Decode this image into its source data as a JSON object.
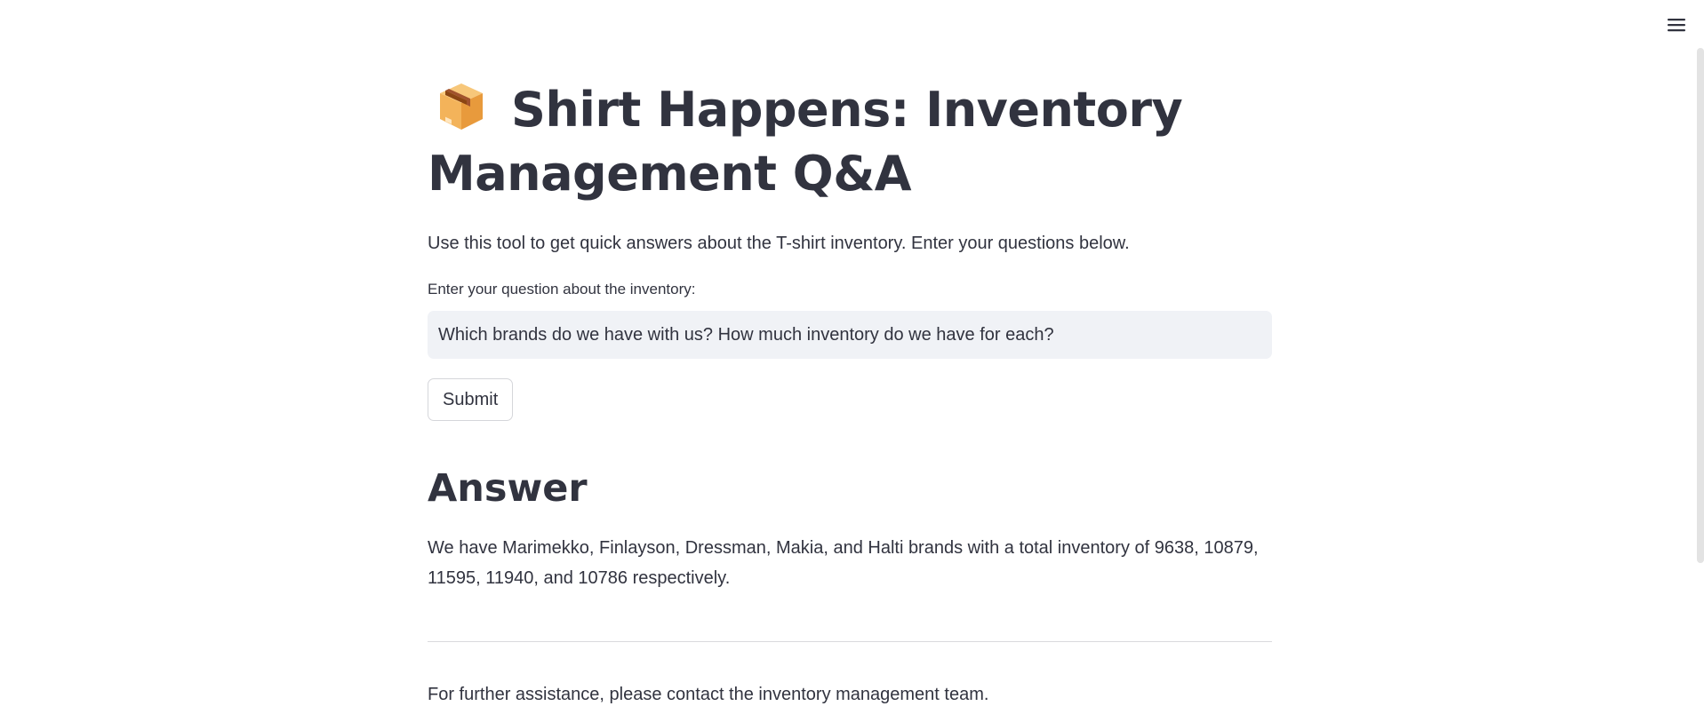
{
  "header": {
    "menu_icon": "hamburger-menu-icon"
  },
  "page": {
    "title_icon": "package-box-icon",
    "title": "Shirt Happens: Inventory Management Q&A",
    "intro": "Use this tool to get quick answers about the T-shirt inventory. Enter your questions below."
  },
  "question": {
    "label": "Enter your question about the inventory:",
    "value": "Which brands do we have with us? How much inventory do we have for each?"
  },
  "actions": {
    "submit_label": "Submit"
  },
  "answer": {
    "heading": "Answer",
    "text": "We have Marimekko, Finlayson, Dressman, Makia, and Halti brands with a total inventory of 9638, 10879, 11595, 11940, and 10786 respectively."
  },
  "footer": {
    "text": "For further assistance, please contact the inventory management team."
  }
}
